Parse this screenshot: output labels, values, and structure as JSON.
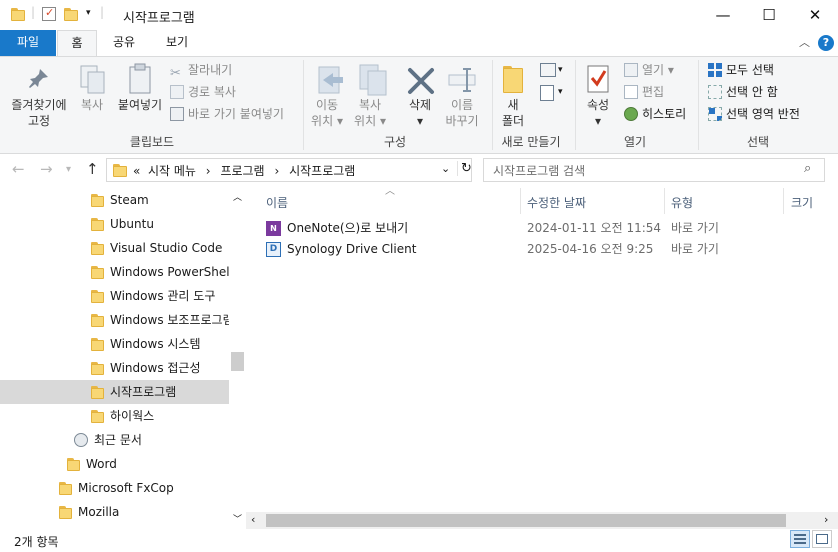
{
  "title_bar": {
    "title": "시작프로그램",
    "min": "—",
    "max": "☐",
    "close": "✕"
  },
  "ribbon_tabs": {
    "file": "파일",
    "home": "홈",
    "share": "공유",
    "view": "보기"
  },
  "ribbon": {
    "clipboard": {
      "pin_label1": "즐겨찾기에",
      "pin_label2": "고정",
      "copy": "복사",
      "paste": "붙여넣기",
      "cut": "잘라내기",
      "copy_path": "경로 복사",
      "paste_shortcut": "바로 가기 붙여넣기",
      "group": "클립보드"
    },
    "organize": {
      "move1": "이동",
      "move2": "위치",
      "copyto1": "복사",
      "copyto2": "위치",
      "delete": "삭제",
      "rename1": "이름",
      "rename2": "바꾸기",
      "group": "구성"
    },
    "new": {
      "folder1": "새",
      "folder2": "폴더",
      "group": "새로 만들기"
    },
    "open": {
      "props": "속성",
      "open": "열기",
      "edit": "편집",
      "history": "히스토리",
      "group": "열기"
    },
    "select": {
      "all": "모두 선택",
      "none": "선택 안 함",
      "invert": "선택 영역 반전",
      "group": "선택"
    }
  },
  "address": {
    "prefix": "«",
    "crumbs": [
      "시작 메뉴",
      "프로그램",
      "시작프로그램"
    ],
    "search_placeholder": "시작프로그램 검색"
  },
  "nav": [
    {
      "label": "Steam"
    },
    {
      "label": "Ubuntu"
    },
    {
      "label": "Visual Studio Code"
    },
    {
      "label": "Windows PowerShell"
    },
    {
      "label": "Windows 관리 도구"
    },
    {
      "label": "Windows 보조프로그램"
    },
    {
      "label": "Windows 시스템"
    },
    {
      "label": "Windows 접근성"
    },
    {
      "label": "시작프로그램"
    },
    {
      "label": "하이웍스"
    },
    {
      "label": "최근 문서"
    },
    {
      "label": "Word"
    },
    {
      "label": "Microsoft FxCop"
    },
    {
      "label": "Mozilla"
    }
  ],
  "columns": {
    "name": "이름",
    "date": "수정한 날짜",
    "type": "유형",
    "size": "크기"
  },
  "files": [
    {
      "name": "OneNote(으)로 보내기",
      "date": "2024-01-11 오전 11:54",
      "type": "바로 가기"
    },
    {
      "name": "Synology Drive Client",
      "date": "2025-04-16 오전 9:25",
      "type": "바로 가기"
    }
  ],
  "status": {
    "count": "2개 항목"
  },
  "colors": {
    "accent": "#1979ca",
    "folder": "#f8d775",
    "selection": "#d9d9d9"
  }
}
